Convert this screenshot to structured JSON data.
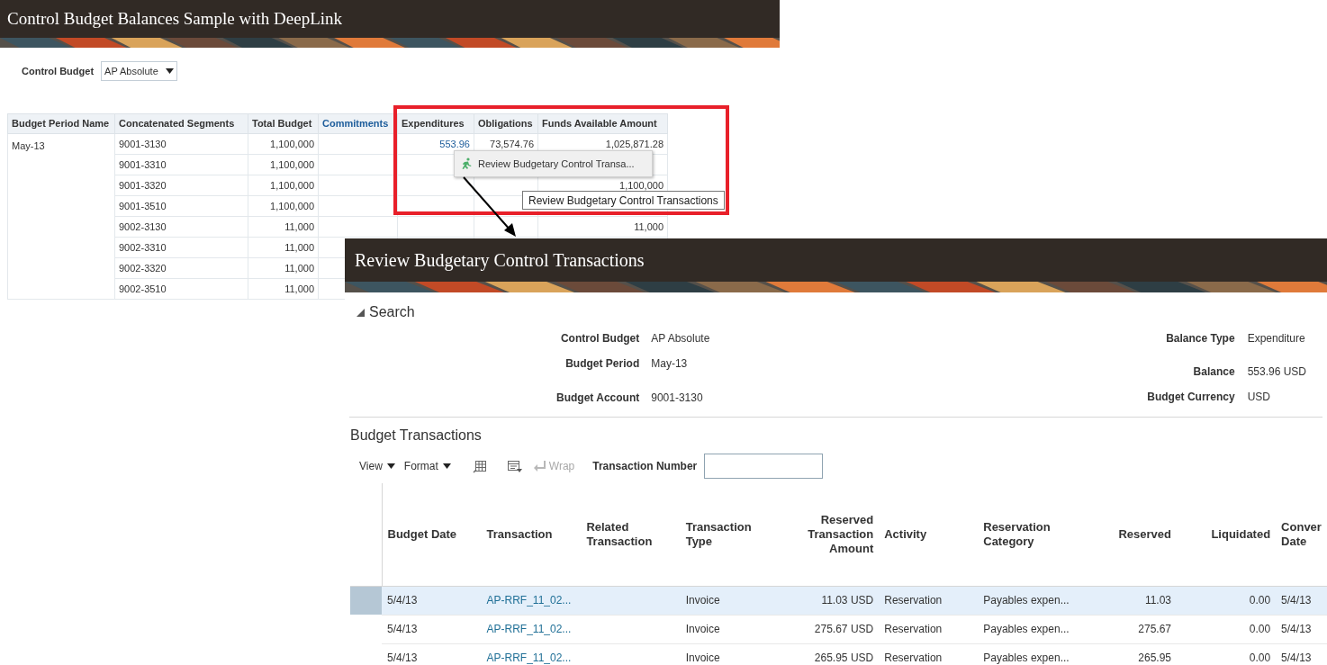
{
  "page": {
    "title": "Control Budget Balances Sample with DeepLink"
  },
  "filter": {
    "label": "Control Budget",
    "value": "AP Absolute"
  },
  "balances_table": {
    "columns": [
      {
        "label": "Budget Period Name",
        "kind": "text"
      },
      {
        "label": "Concatenated Segments",
        "kind": "text"
      },
      {
        "label": "Total Budget",
        "kind": "number"
      },
      {
        "label": "Commitments",
        "kind": "link"
      },
      {
        "label": "Expenditures",
        "kind": "number"
      },
      {
        "label": "Obligations",
        "kind": "number"
      },
      {
        "label": "Funds Available Amount",
        "kind": "number"
      }
    ],
    "groups": [
      {
        "period": "May-13",
        "rows": [
          {
            "cells": [
              "9001-3130",
              "1,100,000",
              "",
              "553.96",
              "73,574.76",
              "1,025,871.28"
            ]
          },
          {
            "cells": [
              "9001-3310",
              "1,100,000",
              "",
              "",
              "",
              ""
            ]
          },
          {
            "cells": [
              "9001-3320",
              "1,100,000",
              "",
              "",
              "",
              "1,100,000"
            ]
          },
          {
            "cells": [
              "9001-3510",
              "1,100,000",
              "",
              "",
              "",
              ""
            ]
          },
          {
            "cells": [
              "9002-3130",
              "11,000",
              "",
              "",
              "",
              "11,000"
            ]
          },
          {
            "cells": [
              "9002-3310",
              "11,000",
              "",
              "",
              "",
              ""
            ]
          },
          {
            "cells": [
              "9002-3320",
              "11,000",
              "",
              "",
              "",
              ""
            ]
          },
          {
            "cells": [
              "9002-3510",
              "11,000",
              "",
              "",
              "",
              ""
            ]
          }
        ]
      }
    ]
  },
  "context_menu": {
    "items": [
      {
        "label": "Review Budgetary Control Transa..."
      }
    ]
  },
  "tooltip": "Review Budgetary Control Transactions",
  "detail_window": {
    "title": "Review Budgetary Control Transactions",
    "search": {
      "label": "Search",
      "expanded": true
    },
    "fields_left": [
      {
        "label": "Control Budget",
        "value": "AP Absolute"
      },
      {
        "label": "Budget Period",
        "value": "May-13"
      },
      {
        "label": "Budget Account",
        "value": "9001-3130"
      }
    ],
    "fields_right": [
      {
        "label": "Balance Type",
        "value": "Expenditure"
      },
      {
        "label": "Balance",
        "value": "553.96 USD"
      },
      {
        "label": "Budget Currency",
        "value": "USD"
      }
    ],
    "section_title": "Budget Transactions",
    "toolbar": {
      "menus": [
        "View",
        "Format"
      ],
      "wrap": {
        "label": "Wrap",
        "disabled": true
      },
      "filter_label": "Transaction Number"
    },
    "table": {
      "columns": [
        {
          "label": "Budget Date",
          "kind": "text"
        },
        {
          "label": "Transaction",
          "kind": "link"
        },
        {
          "label": "Related Transaction",
          "kind": "text"
        },
        {
          "label": "Transaction Type",
          "kind": "text"
        },
        {
          "label": "Reserved Transaction Amount",
          "kind": "number"
        },
        {
          "label": "Activity",
          "kind": "text"
        },
        {
          "label": "Reservation Category",
          "kind": "text"
        },
        {
          "label": "Reserved",
          "kind": "number"
        },
        {
          "label": "Liquidated",
          "kind": "number"
        },
        {
          "label": "Conver Date",
          "kind": "text"
        }
      ],
      "rows": [
        {
          "selected": true,
          "cells": [
            "5/4/13",
            "AP-RRF_11_02...",
            "",
            "Invoice",
            "11.03 USD",
            "Reservation",
            "Payables expen...",
            "11.03",
            "0.00",
            "5/4/13"
          ]
        },
        {
          "selected": false,
          "cells": [
            "5/4/13",
            "AP-RRF_11_02...",
            "",
            "Invoice",
            "275.67 USD",
            "Reservation",
            "Payables expen...",
            "275.67",
            "0.00",
            "5/4/13"
          ]
        },
        {
          "selected": false,
          "cells": [
            "5/4/13",
            "AP-RRF_11_02...",
            "",
            "Invoice",
            "265.95 USD",
            "Reservation",
            "Payables expen...",
            "265.95",
            "0.00",
            "5/4/13"
          ]
        }
      ]
    }
  }
}
